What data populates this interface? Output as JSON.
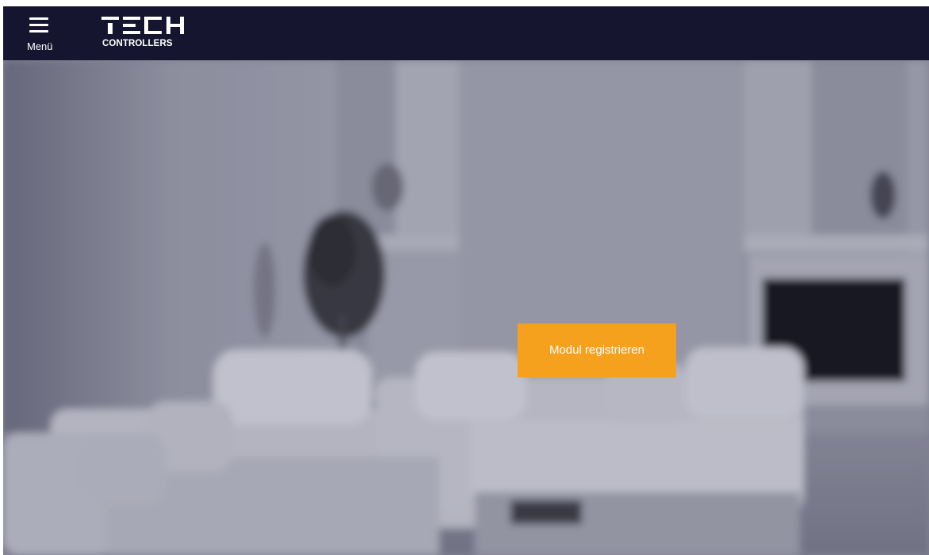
{
  "header": {
    "menu_icon": "hamburger-menu-icon",
    "menu_label": "Menü",
    "logo": {
      "wordmark": "TECH",
      "subtitle": "CONTROLLERS"
    },
    "background_color": "#151530"
  },
  "hero": {
    "background": "blurred grayscale living room photo",
    "register_button_label": "Modul registrieren",
    "register_button_color": "#f5a11d"
  }
}
